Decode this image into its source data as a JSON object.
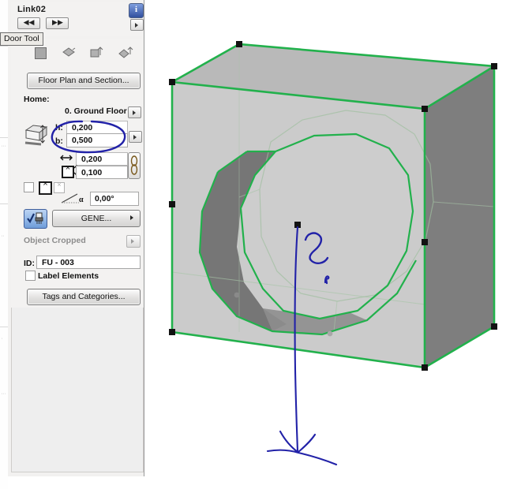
{
  "window": {
    "object_title": "Link02",
    "tooltip": "Door Tool"
  },
  "header": {
    "nav_back_label": "◀◀",
    "nav_forward_label": "▶▶",
    "info_label": "i",
    "settings_arrow_label": "▶"
  },
  "toolbar_icons": [
    "geometry-method-plain-icon",
    "geometry-method-rotated-icon",
    "geometry-method-raised-icon",
    "geometry-method-rotated-raised-icon"
  ],
  "buttons": {
    "floor_plan_and_section": "Floor Plan and Section...",
    "gene": "GENE...",
    "tags_and_categories": "Tags and Categories..."
  },
  "home_section": {
    "label": "Home:",
    "story_value": "0. Ground Floor"
  },
  "dimensions": {
    "height_label": "h:",
    "height_value": "0,200",
    "width_label": "b:",
    "width_value": "0,500",
    "horizontal_value": "0,200",
    "vertical_value": "0,100",
    "angle_value": "0,00°"
  },
  "object_section": {
    "object_cropped_label": "Object Cropped"
  },
  "id_section": {
    "id_label": "ID:",
    "id_value": "FU - 003",
    "label_elements": "Label Elements"
  },
  "colors": {
    "selection_green": "#22b14c",
    "annotation_blue": "#2222a8",
    "accent_blue": "#31509f",
    "panel_grey": "#f2f1f0",
    "face_light": "#cbcbcb",
    "face_top": "#b9b9b9",
    "face_right": "#7e7e7e",
    "hole_inner": "#6f6f6f"
  },
  "annotations": {
    "handwritten_mark": "2",
    "arrow": "hand-drawn-down-arrow"
  },
  "viewport": {
    "model": "box-with-cylindrical-hole",
    "hotspots": 8
  }
}
